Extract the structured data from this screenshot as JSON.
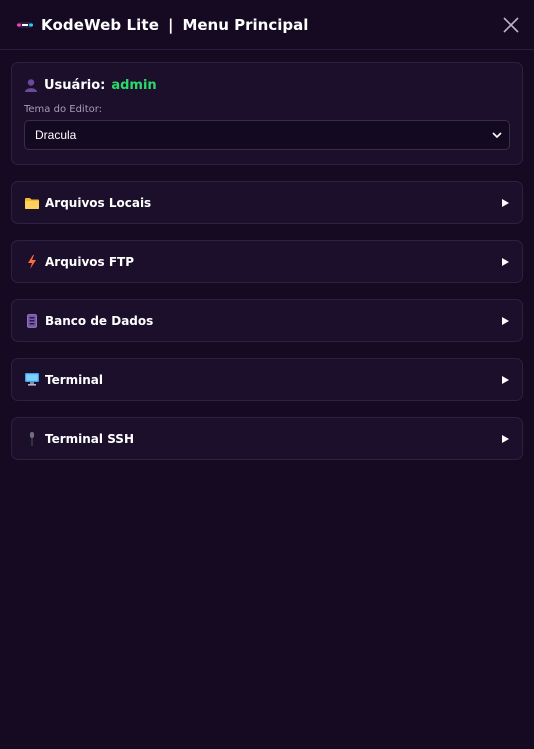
{
  "header": {
    "app_title": "KodeWeb Lite",
    "separator": "|",
    "menu_title": "Menu Principal"
  },
  "user": {
    "label": "Usuário:",
    "name": "admin",
    "name_color": "#2bd96a"
  },
  "editor_theme": {
    "label": "Tema do Editor:",
    "selected": "Dracula"
  },
  "sections": [
    {
      "label": "Arquivos Locais",
      "icon": "folder-icon"
    },
    {
      "label": "Arquivos FTP",
      "icon": "lightning-icon"
    },
    {
      "label": "Banco de Dados",
      "icon": "database-icon"
    },
    {
      "label": "Terminal",
      "icon": "monitor-icon"
    },
    {
      "label": "Terminal SSH",
      "icon": "microphone-icon"
    }
  ],
  "colors": {
    "background": "#150a22",
    "card": "#1c0f2c",
    "accent_green": "#2bd96a"
  }
}
